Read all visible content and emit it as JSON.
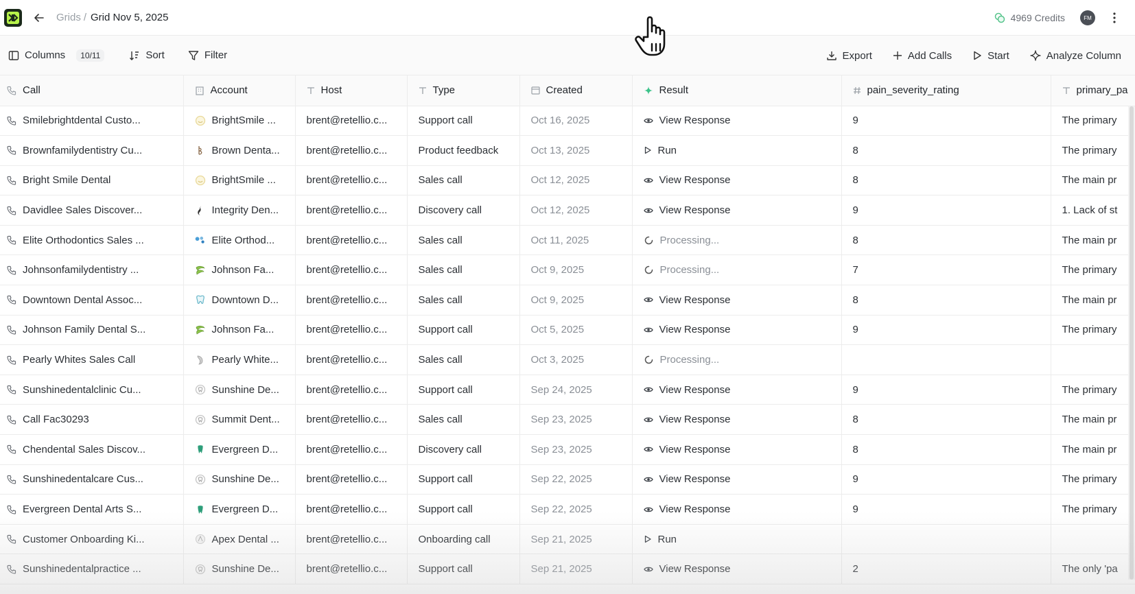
{
  "header": {
    "breadcrumb_parent": "Grids",
    "breadcrumb_sep": "/",
    "title": "Grid Nov 5, 2025",
    "credits": "4969 Credits",
    "avatar_initials": "FM"
  },
  "toolbar": {
    "columns_label": "Columns",
    "columns_count": "10/11",
    "sort_label": "Sort",
    "filter_label": "Filter",
    "export_label": "Export",
    "add_calls_label": "Add Calls",
    "start_label": "Start",
    "analyze_label": "Analyze Column"
  },
  "columns": {
    "call": "Call",
    "account": "Account",
    "host": "Host",
    "type": "Type",
    "created": "Created",
    "result": "Result",
    "pain": "pain_severity_rating",
    "primary": "primary_pa"
  },
  "rows": [
    {
      "call": "Smilebrightdental Custo...",
      "account": "BrightSmile ...",
      "acc_icon": "smile-logo-icon",
      "host": "brent@retellio.c...",
      "type": "Support call",
      "created": "Oct 16, 2025",
      "result": "View Response",
      "result_kind": "view",
      "pain": "9",
      "primary": "The primary"
    },
    {
      "call": "Brownfamilydentistry Cu...",
      "account": "Brown Denta...",
      "acc_icon": "brown-logo-icon",
      "host": "brent@retellio.c...",
      "type": "Product feedback",
      "created": "Oct 13, 2025",
      "result": "Run",
      "result_kind": "run",
      "pain": "8",
      "primary": "The primary"
    },
    {
      "call": "Bright Smile Dental",
      "account": "BrightSmile ...",
      "acc_icon": "smile-logo-icon",
      "host": "brent@retellio.c...",
      "type": "Sales call",
      "created": "Oct 12, 2025",
      "result": "View Response",
      "result_kind": "view",
      "pain": "8",
      "primary": "The main pr"
    },
    {
      "call": "Davidlee Sales Discover...",
      "account": "Integrity Den...",
      "acc_icon": "integrity-logo-icon",
      "host": "brent@retellio.c...",
      "type": "Discovery call",
      "created": "Oct 12, 2025",
      "result": "View Response",
      "result_kind": "view",
      "pain": "9",
      "primary": "1. Lack of st"
    },
    {
      "call": "Elite Orthodontics Sales ...",
      "account": "Elite Orthod...",
      "acc_icon": "elite-logo-icon",
      "host": "brent@retellio.c...",
      "type": "Sales call",
      "created": "Oct 11, 2025",
      "result": "Processing...",
      "result_kind": "processing",
      "pain": "8",
      "primary": "The main pr"
    },
    {
      "call": "Johnsonfamilydentistry ...",
      "account": "Johnson Fa...",
      "acc_icon": "johnson-logo-icon",
      "host": "brent@retellio.c...",
      "type": "Sales call",
      "created": "Oct 9, 2025",
      "result": "Processing...",
      "result_kind": "processing",
      "pain": "7",
      "primary": "The primary"
    },
    {
      "call": "Downtown Dental Assoc...",
      "account": "Downtown D...",
      "acc_icon": "downtown-logo-icon",
      "host": "brent@retellio.c...",
      "type": "Sales call",
      "created": "Oct 9, 2025",
      "result": "View Response",
      "result_kind": "view",
      "pain": "8",
      "primary": "The main pr"
    },
    {
      "call": "Johnson Family Dental S...",
      "account": "Johnson Fa...",
      "acc_icon": "johnson-logo-icon",
      "host": "brent@retellio.c...",
      "type": "Support call",
      "created": "Oct 5, 2025",
      "result": "View Response",
      "result_kind": "view",
      "pain": "9",
      "primary": "The primary"
    },
    {
      "call": "Pearly Whites Sales Call",
      "account": "Pearly White...",
      "acc_icon": "pearly-logo-icon",
      "host": "brent@retellio.c...",
      "type": "Sales call",
      "created": "Oct 3, 2025",
      "result": "Processing...",
      "result_kind": "processing",
      "pain": "",
      "primary": ""
    },
    {
      "call": "Sunshinedentalclinic Cu...",
      "account": "Sunshine De...",
      "acc_icon": "sunshine-logo-icon",
      "host": "brent@retellio.c...",
      "type": "Support call",
      "created": "Sep 24, 2025",
      "result": "View Response",
      "result_kind": "view",
      "pain": "9",
      "primary": "The primary"
    },
    {
      "call": "Call Fac30293",
      "account": "Summit Dent...",
      "acc_icon": "summit-logo-icon",
      "host": "brent@retellio.c...",
      "type": "Sales call",
      "created": "Sep 23, 2025",
      "result": "View Response",
      "result_kind": "view",
      "pain": "8",
      "primary": "The main pr"
    },
    {
      "call": "Chendental Sales Discov...",
      "account": "Evergreen D...",
      "acc_icon": "evergreen-logo-icon",
      "host": "brent@retellio.c...",
      "type": "Discovery call",
      "created": "Sep 23, 2025",
      "result": "View Response",
      "result_kind": "view",
      "pain": "8",
      "primary": "The main pr"
    },
    {
      "call": "Sunshinedentalcare Cus...",
      "account": "Sunshine De...",
      "acc_icon": "sunshine-logo-icon",
      "host": "brent@retellio.c...",
      "type": "Support call",
      "created": "Sep 22, 2025",
      "result": "View Response",
      "result_kind": "view",
      "pain": "9",
      "primary": "The primary"
    },
    {
      "call": "Evergreen Dental Arts S...",
      "account": "Evergreen D...",
      "acc_icon": "evergreen-logo-icon",
      "host": "brent@retellio.c...",
      "type": "Support call",
      "created": "Sep 22, 2025",
      "result": "View Response",
      "result_kind": "view",
      "pain": "9",
      "primary": "The primary"
    },
    {
      "call": "Customer Onboarding Ki...",
      "account": "Apex Dental ...",
      "acc_icon": "apex-logo-icon",
      "host": "brent@retellio.c...",
      "type": "Onboarding call",
      "created": "Sep 21, 2025",
      "result": "Run",
      "result_kind": "run",
      "pain": "",
      "primary": ""
    },
    {
      "call": "Sunshinedentalpractice ...",
      "account": "Sunshine De...",
      "acc_icon": "sunshine-logo-icon",
      "host": "brent@retellio.c...",
      "type": "Support call",
      "created": "Sep 21, 2025",
      "result": "View Response",
      "result_kind": "view",
      "pain": "2",
      "primary": "The only 'pa"
    }
  ],
  "colors": {
    "brand": "#b7f34a",
    "credits_icon": "#57c48c",
    "result_header_icon": "#3cc38a"
  }
}
